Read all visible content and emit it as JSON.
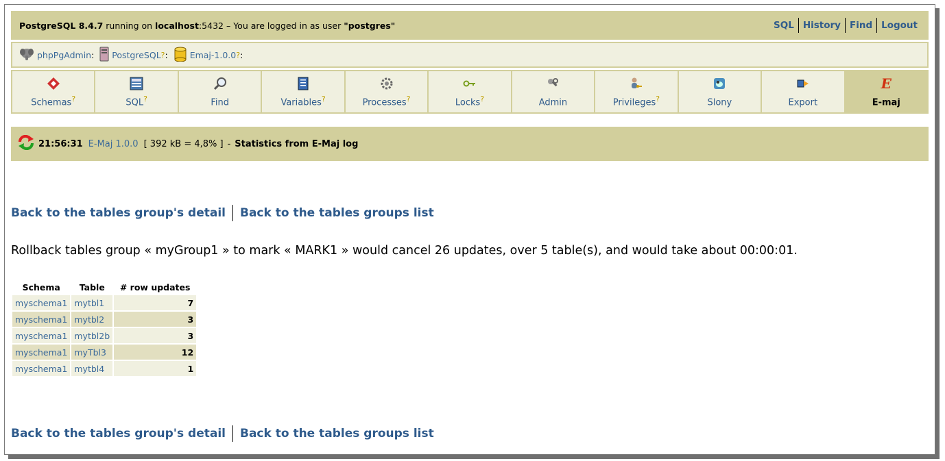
{
  "topbar": {
    "product": "PostgreSQL 8.4.7",
    "running_on": "running on",
    "host": "localhost",
    "port": ":5432",
    "logged_text": "– You are logged in as user",
    "user": "\"postgres\"",
    "links": [
      "SQL",
      "History",
      "Find",
      "Logout"
    ]
  },
  "trail": {
    "items": [
      {
        "label": "phpPgAdmin",
        "suffix": ":"
      },
      {
        "label": "PostgreSQL",
        "suffix": ":"
      },
      {
        "label": "Emaj-1.0.0",
        "suffix": ":"
      }
    ],
    "help_mark": "?"
  },
  "tabs": [
    {
      "label": "Schemas",
      "help": "?"
    },
    {
      "label": "SQL",
      "help": "?"
    },
    {
      "label": "Find",
      "help": ""
    },
    {
      "label": "Variables",
      "help": "?"
    },
    {
      "label": "Processes",
      "help": "?"
    },
    {
      "label": "Locks",
      "help": "?"
    },
    {
      "label": "Admin",
      "help": ""
    },
    {
      "label": "Privileges",
      "help": "?"
    },
    {
      "label": "Slony",
      "help": ""
    },
    {
      "label": "Export",
      "help": ""
    },
    {
      "label": "E-maj",
      "help": ""
    }
  ],
  "status": {
    "time": "21:56:31",
    "version": "E-Maj 1.0.0",
    "size": "[ 392 kB = 4,8% ]",
    "separator": "-",
    "title": "Statistics from E-Maj log"
  },
  "nav_links": {
    "detail": "Back to the tables group's detail",
    "list": "Back to the tables groups list"
  },
  "message": "Rollback tables group « myGroup1 » to mark « MARK1 » would cancel 26 updates, over 5 table(s), and would take about 00:00:01.",
  "table": {
    "headers": [
      "Schema",
      "Table",
      "# row updates"
    ],
    "rows": [
      [
        "myschema1",
        "mytbl1",
        "7"
      ],
      [
        "myschema1",
        "mytbl2",
        "3"
      ],
      [
        "myschema1",
        "mytbl2b",
        "3"
      ],
      [
        "myschema1",
        "myTbl3",
        "12"
      ],
      [
        "myschema1",
        "mytbl4",
        "1"
      ]
    ]
  },
  "colors": {
    "bar": "#d2cf9c",
    "light_bg": "#f0f0e0",
    "link": "#2f5b8c",
    "row_alt": "#e2dfc0"
  }
}
